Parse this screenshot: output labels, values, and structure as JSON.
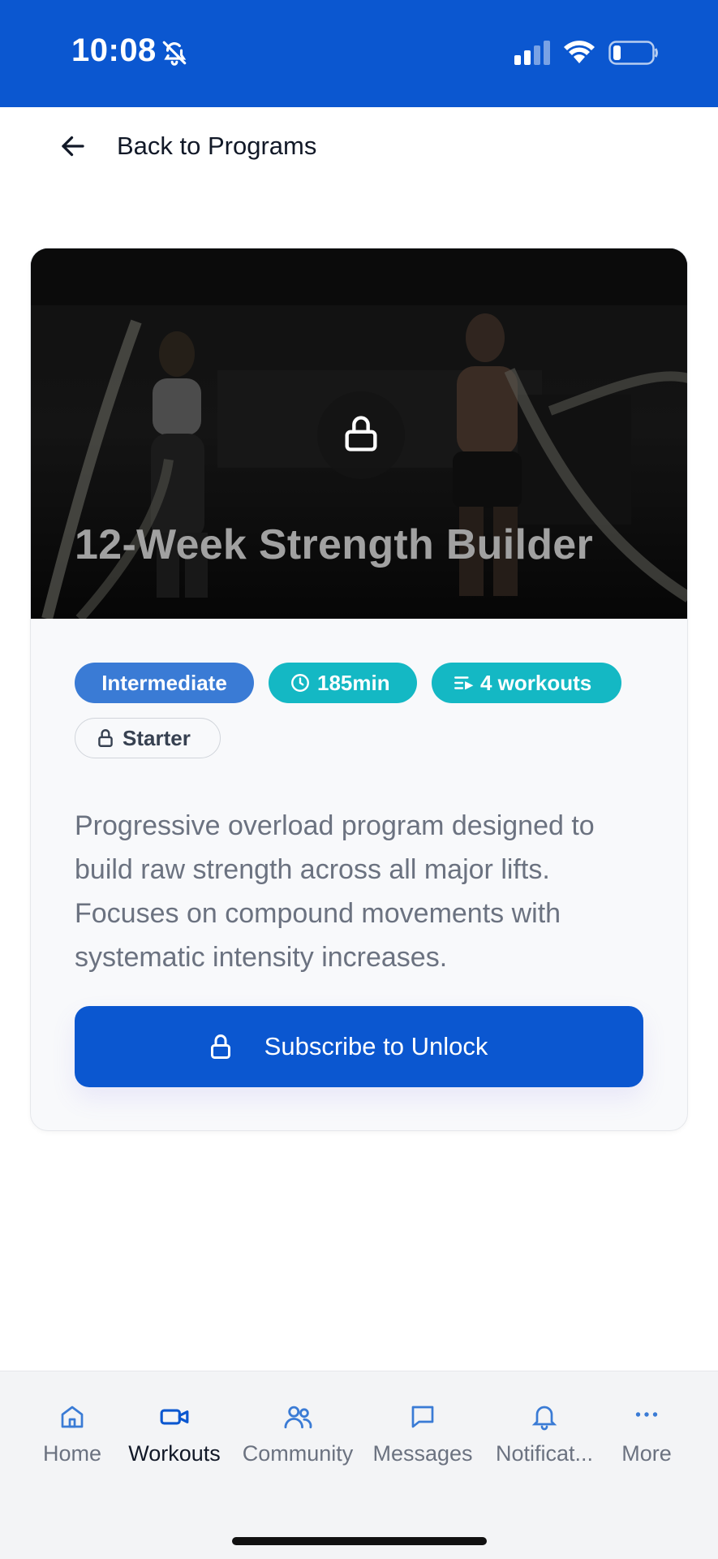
{
  "status_bar": {
    "time": "10:08"
  },
  "header": {
    "back_label": "Back to Programs"
  },
  "program": {
    "title": "12-Week Strength Builder",
    "level": "Intermediate",
    "duration": "185min",
    "workouts": "4 workouts",
    "tier": "Starter",
    "description": "Progressive overload program designed to build raw strength across all major lifts. Focuses on compound movements with systematic intensity increases.",
    "cta_label": "Subscribe to Unlock"
  },
  "tabs": [
    {
      "label": "Home",
      "icon": "home-icon"
    },
    {
      "label": "Workouts",
      "icon": "video-icon",
      "active": true
    },
    {
      "label": "Community",
      "icon": "users-icon"
    },
    {
      "label": "Messages",
      "icon": "message-icon"
    },
    {
      "label": "Notificat...",
      "icon": "bell-icon"
    },
    {
      "label": "More",
      "icon": "more-icon"
    }
  ],
  "colors": {
    "brand_blue": "#0b57d0",
    "level_badge": "#3a7bd5",
    "teal_badge": "#14b8c4"
  }
}
